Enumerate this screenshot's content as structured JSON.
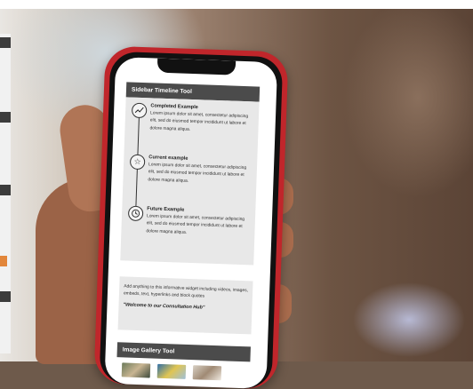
{
  "widget": {
    "title": "Sidebar Timeline Tool",
    "items": [
      {
        "icon": "chart-icon",
        "title": "Completed Example",
        "body": "Lorem ipsum dolor sit amet, consectetur adipiscing elit, sed do eiusmod tempor incididunt ut labore et dolore magna aliqua."
      },
      {
        "icon": "star-icon",
        "title": "Current example",
        "body": "Lorem ipsum dolor sit amet, consectetur adipiscing elit, sed do eiusmod tempor incididunt ut labore et dolore magna aliqua."
      },
      {
        "icon": "clock-icon",
        "title": "Future Example",
        "body": "Lorem ipsum dolor sit amet, consectetur adipiscing elit, sed do eiusmod tempor incididunt ut labore et dolore magna aliqua."
      }
    ]
  },
  "info": {
    "body": "Add anything to this informative widget including videos, images, embeds, text, hyperlinks and block quotes",
    "quote": "\"Welcome to our Consultation Hub\""
  },
  "gallery": {
    "title": "Image Gallery Tool"
  },
  "colors": {
    "phone_frame": "#c0262b",
    "header_bg": "#4b4b4b",
    "panel_bg": "#e8e8e8"
  }
}
